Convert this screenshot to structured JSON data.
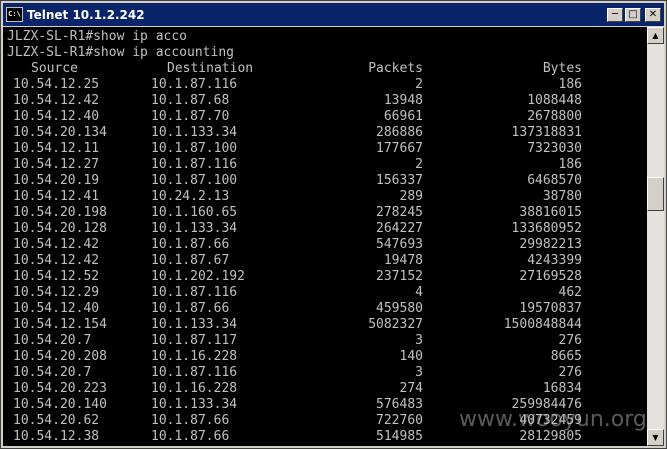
{
  "window": {
    "title": "Telnet 10.1.2.242",
    "icon_label": "C:\\",
    "minimize_icon": "minimize-icon",
    "maximize_icon": "maximize-icon",
    "close_icon": "close-icon"
  },
  "console": {
    "commands": [
      "JLZX-SL-R1#show ip acco",
      "JLZX-SL-R1#show ip accounting"
    ],
    "headers": {
      "source": "Source",
      "destination": "Destination",
      "packets": "Packets",
      "bytes": "Bytes"
    },
    "rows": [
      {
        "source": "10.54.12.25",
        "destination": "10.1.87.116",
        "packets": "2",
        "bytes": "186"
      },
      {
        "source": "10.54.12.42",
        "destination": "10.1.87.68",
        "packets": "13948",
        "bytes": "1088448"
      },
      {
        "source": "10.54.12.40",
        "destination": "10.1.87.70",
        "packets": "66961",
        "bytes": "2678800"
      },
      {
        "source": "10.54.20.134",
        "destination": "10.1.133.34",
        "packets": "286886",
        "bytes": "137318831"
      },
      {
        "source": "10.54.12.11",
        "destination": "10.1.87.100",
        "packets": "177667",
        "bytes": "7323030"
      },
      {
        "source": "10.54.12.27",
        "destination": "10.1.87.116",
        "packets": "2",
        "bytes": "186"
      },
      {
        "source": "10.54.20.19",
        "destination": "10.1.87.100",
        "packets": "156337",
        "bytes": "6468570"
      },
      {
        "source": "10.54.12.41",
        "destination": "10.24.2.13",
        "packets": "289",
        "bytes": "38780"
      },
      {
        "source": "10.54.20.198",
        "destination": "10.1.160.65",
        "packets": "278245",
        "bytes": "38816015"
      },
      {
        "source": "10.54.20.128",
        "destination": "10.1.133.34",
        "packets": "264227",
        "bytes": "133680952"
      },
      {
        "source": "10.54.12.42",
        "destination": "10.1.87.66",
        "packets": "547693",
        "bytes": "29982213"
      },
      {
        "source": "10.54.12.42",
        "destination": "10.1.87.67",
        "packets": "19478",
        "bytes": "4243399"
      },
      {
        "source": "10.54.12.52",
        "destination": "10.1.202.192",
        "packets": "237152",
        "bytes": "27169528"
      },
      {
        "source": "10.54.12.29",
        "destination": "10.1.87.116",
        "packets": "4",
        "bytes": "462"
      },
      {
        "source": "10.54.12.40",
        "destination": "10.1.87.66",
        "packets": "459580",
        "bytes": "19570837"
      },
      {
        "source": "10.54.12.154",
        "destination": "10.1.133.34",
        "packets": "5082327",
        "bytes": "1500848844"
      },
      {
        "source": "10.54.20.7",
        "destination": "10.1.87.117",
        "packets": "3",
        "bytes": "276"
      },
      {
        "source": "10.54.20.208",
        "destination": "10.1.16.228",
        "packets": "140",
        "bytes": "8665"
      },
      {
        "source": "10.54.20.7",
        "destination": "10.1.87.116",
        "packets": "3",
        "bytes": "276"
      },
      {
        "source": "10.54.20.223",
        "destination": "10.1.16.228",
        "packets": "274",
        "bytes": "16834"
      },
      {
        "source": "10.54.20.140",
        "destination": "10.1.133.34",
        "packets": "576483",
        "bytes": "259984476"
      },
      {
        "source": "10.54.20.62",
        "destination": "10.1.87.66",
        "packets": "722760",
        "bytes": "40732459"
      },
      {
        "source": "10.54.12.38",
        "destination": "10.1.87.66",
        "packets": "514985",
        "bytes": "28129805"
      }
    ]
  },
  "scrollbar": {
    "up_icon": "scroll-up-icon",
    "down_icon": "scroll-down-icon"
  },
  "watermark": "www.wooyun.org",
  "colors": {
    "titlebar": "#0a246a",
    "console_bg": "#000000",
    "console_text": "#c0c0c0",
    "chrome": "#d4d0c8"
  }
}
